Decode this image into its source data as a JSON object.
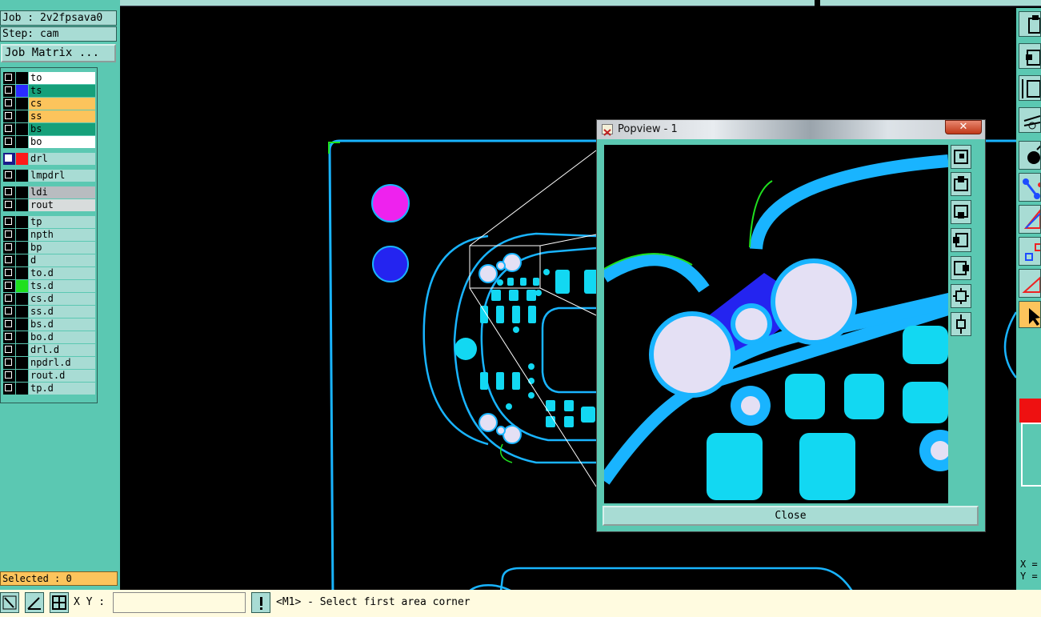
{
  "job": {
    "label": "Job : 2v2fpsava0",
    "step": "Step: cam",
    "matrix_button": "Job Matrix ..."
  },
  "layers": [
    {
      "name": "to",
      "bg": "#ffffff",
      "swatch": "#000000",
      "checked": false
    },
    {
      "name": "ts",
      "bg": "#16a07a",
      "swatch": "#2b2bff",
      "checked": false
    },
    {
      "name": "cs",
      "bg": "#fcc45c",
      "swatch": "#000000",
      "checked": false
    },
    {
      "name": "ss",
      "bg": "#fcc45c",
      "swatch": "#000000",
      "checked": false
    },
    {
      "name": "bs",
      "bg": "#16a07a",
      "swatch": "#000000",
      "checked": false
    },
    {
      "name": "bo",
      "bg": "#ffffff",
      "swatch": "#000000",
      "checked": false
    },
    {
      "name": "drl",
      "bg": "#a8dcd4",
      "swatch": "#ff1a1a",
      "checked": true
    },
    {
      "name": "lmpdrl",
      "bg": "#a8dcd4",
      "swatch": "#000000",
      "checked": false
    },
    {
      "name": "ldi",
      "bg": "#b8bcc0",
      "swatch": "#000000",
      "checked": false
    },
    {
      "name": "rout",
      "bg": "#d8dcdc",
      "swatch": "#000000",
      "checked": false
    },
    {
      "name": "tp",
      "bg": "#a8dcd4",
      "swatch": "#000000",
      "checked": false
    },
    {
      "name": "npth",
      "bg": "#a8dcd4",
      "swatch": "#000000",
      "checked": false
    },
    {
      "name": "bp",
      "bg": "#a8dcd4",
      "swatch": "#000000",
      "checked": false
    },
    {
      "name": "d",
      "bg": "#a8dcd4",
      "swatch": "#000000",
      "checked": false
    },
    {
      "name": "to.d",
      "bg": "#a8dcd4",
      "swatch": "#000000",
      "checked": false
    },
    {
      "name": "ts.d",
      "bg": "#a8dcd4",
      "swatch": "#1fe01f",
      "checked": false
    },
    {
      "name": "cs.d",
      "bg": "#a8dcd4",
      "swatch": "#000000",
      "checked": false
    },
    {
      "name": "ss.d",
      "bg": "#a8dcd4",
      "swatch": "#000000",
      "checked": false
    },
    {
      "name": "bs.d",
      "bg": "#a8dcd4",
      "swatch": "#000000",
      "checked": false
    },
    {
      "name": "bo.d",
      "bg": "#a8dcd4",
      "swatch": "#000000",
      "checked": false
    },
    {
      "name": "drl.d",
      "bg": "#a8dcd4",
      "swatch": "#000000",
      "checked": false
    },
    {
      "name": "npdrl.d",
      "bg": "#a8dcd4",
      "swatch": "#000000",
      "checked": false
    },
    {
      "name": "rout.d",
      "bg": "#a8dcd4",
      "swatch": "#000000",
      "checked": false
    },
    {
      "name": "tp.d",
      "bg": "#a8dcd4",
      "swatch": "#000000",
      "checked": false
    }
  ],
  "selected": "Selected : 0",
  "statusbar": {
    "xy_label": "X Y :",
    "xy_value": "",
    "prompt": "<M1> - Select first area corner"
  },
  "popview": {
    "title": "Popview - 1",
    "close_label": "Close"
  },
  "coords": {
    "x_label": "X =",
    "y_label": "Y ="
  },
  "colors": {
    "panel": "#5bc8b2",
    "button": "#a8dcd4",
    "trace": "#19b4ff",
    "pad": "#12d8f2",
    "hole": "#e4e0f4",
    "fill_blue": "#2424f0",
    "magenta": "#ee22ee"
  }
}
